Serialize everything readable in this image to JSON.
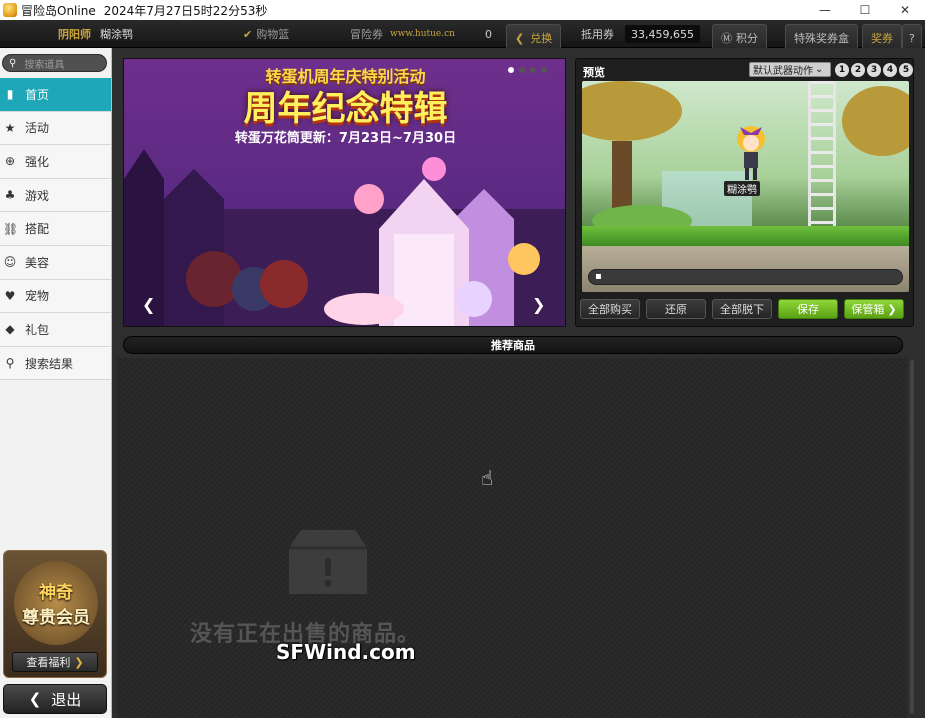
{
  "window": {
    "title": "冒险岛Online",
    "datetime": "2024年7月27日5时22分53秒",
    "controls": {
      "minimize": "—",
      "maximize": "☐",
      "close": "✕"
    }
  },
  "toolbar": {
    "channel_label": "阴阳师",
    "character_name": "糊涂鹗",
    "cart_label": "购物篮",
    "maple_points_label": "冒险券",
    "watermark_url": "www.hutue.cn",
    "maple_points_value": "0",
    "exchange_label": "兑换",
    "nx_label": "抵用券",
    "nx_value": "33,459,655",
    "mileage_label": "积分",
    "special_coupon_label": "特殊奖券盒",
    "reward_label": "奖券",
    "help_label": "?"
  },
  "sidebar": {
    "search_placeholder": "搜索道具",
    "items": [
      {
        "label": "首页",
        "icon": "home-icon",
        "glyph": "▮",
        "active": true
      },
      {
        "label": "活动",
        "icon": "star-icon",
        "glyph": "★",
        "active": false
      },
      {
        "label": "强化",
        "icon": "plus-circle-icon",
        "glyph": "⊕",
        "active": false
      },
      {
        "label": "游戏",
        "icon": "gamepad-icon",
        "glyph": "♣",
        "active": false
      },
      {
        "label": "搭配",
        "icon": "hanger-icon",
        "glyph": "⛓",
        "active": false
      },
      {
        "label": "美容",
        "icon": "smile-icon",
        "glyph": "☺",
        "active": false
      },
      {
        "label": "宠物",
        "icon": "heart-icon",
        "glyph": "♥",
        "active": false
      },
      {
        "label": "礼包",
        "icon": "box-icon",
        "glyph": "◆",
        "active": false
      },
      {
        "label": "搜索结果",
        "icon": "search-icon",
        "glyph": "⚲",
        "active": false
      }
    ],
    "vip": {
      "line1": "神奇",
      "line2": "尊贵会员",
      "button": "查看福利"
    },
    "exit_label": "退出"
  },
  "banner": {
    "line1": "转蛋机周年庆特别活动",
    "line2": "周年纪念特辑",
    "line3": "转蛋万花筒更新：7月23日~7月30日",
    "page_count": 4,
    "active_page": 1
  },
  "preview": {
    "title": "预览",
    "action_select": "默认武器动作",
    "slots": [
      "1",
      "2",
      "3",
      "4",
      "5"
    ],
    "character_nameplate": "糊涂鹗",
    "buttons": {
      "buy_all": "全部购买",
      "restore": "还原",
      "remove_all": "全部脱下",
      "save": "保存",
      "storage": "保管箱"
    }
  },
  "recommend": {
    "title": "推荐商品",
    "empty_message": "没有正在出售的商品。"
  },
  "overlay": {
    "watermark": "SFWind.com"
  }
}
